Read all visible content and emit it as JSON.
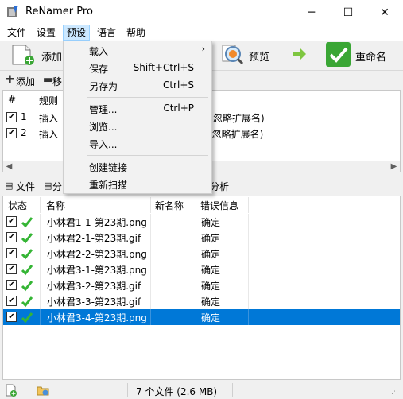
{
  "window": {
    "title": "ReNamer Pro",
    "minimize_glyph": "─",
    "maximize_glyph": "☐",
    "close_glyph": "✕"
  },
  "menubar": {
    "items": [
      "文件",
      "设置",
      "预设",
      "语言",
      "帮助"
    ]
  },
  "toolbar": {
    "add_label": "添加",
    "preview_label": "预览",
    "rename_label": "重命名",
    "icons": [
      "add-files-icon",
      "preview-icon",
      "arrow-right-icon",
      "rename-check-icon"
    ]
  },
  "rules_toolbar": {
    "add_label": "添加",
    "move_label": "移"
  },
  "rules_table": {
    "columns": [
      "#",
      "规则"
    ],
    "rows": [
      {
        "num": "1",
        "rule": "插入",
        "desc": "忽略扩展名)",
        "checked": true
      },
      {
        "num": "2",
        "rule": "插入",
        "desc": "(忽略扩展名)",
        "checked": true
      }
    ]
  },
  "files_toolbar": {
    "files_label": "文件",
    "sort_label": "分",
    "analyze_label": "分析"
  },
  "files_table": {
    "columns": [
      "状态",
      "名称",
      "新名称",
      "错误信息"
    ],
    "rows": [
      {
        "name": "小林君1-1-第23期.png",
        "new_name": "",
        "error": "确定",
        "checked": true,
        "selected": false
      },
      {
        "name": "小林君2-1-第23期.gif",
        "new_name": "",
        "error": "确定",
        "checked": true,
        "selected": false
      },
      {
        "name": "小林君2-2-第23期.png",
        "new_name": "",
        "error": "确定",
        "checked": true,
        "selected": false
      },
      {
        "name": "小林君3-1-第23期.png",
        "new_name": "",
        "error": "确定",
        "checked": true,
        "selected": false
      },
      {
        "name": "小林君3-2-第23期.gif",
        "new_name": "",
        "error": "确定",
        "checked": true,
        "selected": false
      },
      {
        "name": "小林君3-3-第23期.gif",
        "new_name": "",
        "error": "确定",
        "checked": true,
        "selected": false
      },
      {
        "name": "小林君3-4-第23期.png",
        "new_name": "",
        "error": "确定",
        "checked": true,
        "selected": true
      }
    ]
  },
  "statusbar": {
    "summary": "7 个文件 (2.6 MB)"
  },
  "presets_menu": {
    "items": [
      {
        "label": "载入",
        "shortcut": "",
        "submenu": true
      },
      {
        "label": "保存",
        "shortcut": "Shift+Ctrl+S",
        "submenu": false
      },
      {
        "label": "另存为",
        "shortcut": "Ctrl+S",
        "submenu": false
      },
      {
        "label": "管理...",
        "shortcut": "Ctrl+P",
        "submenu": false
      },
      {
        "label": "浏览...",
        "shortcut": "",
        "submenu": false
      },
      {
        "label": "导入...",
        "shortcut": "",
        "submenu": false
      },
      {
        "label": "创建链接",
        "shortcut": "",
        "submenu": false
      },
      {
        "label": "重新扫描",
        "shortcut": "",
        "submenu": false
      }
    ]
  },
  "colors": {
    "selection": "#0078d7",
    "check_green": "#35b535",
    "menu_highlight": "#cce8ff"
  }
}
